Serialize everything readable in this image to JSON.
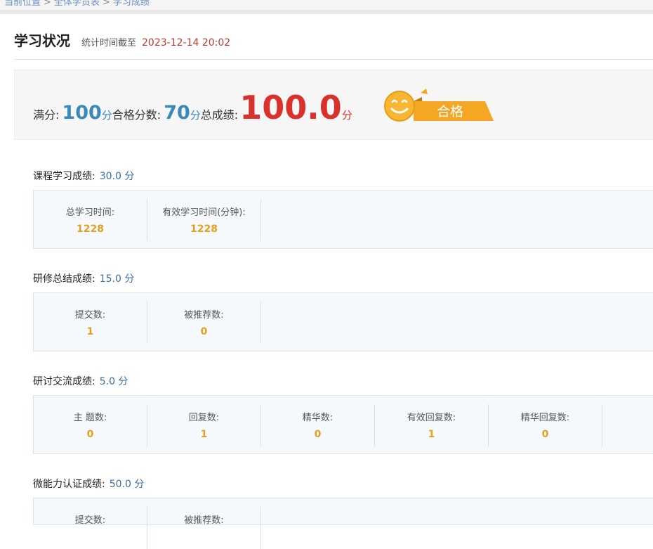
{
  "breadcrumb": [
    "当前位置",
    "全体学员表",
    "学习成绩"
  ],
  "header": {
    "title": "学习状况",
    "stat_label": "统计时间截至",
    "stat_time": "2023-12-14 20:02"
  },
  "summary": {
    "full_label": "满分:",
    "full_value": "100",
    "pass_label": "合格分数:",
    "pass_value": "70",
    "total_label": "总成绩:",
    "total_value": "100.0",
    "unit": "分",
    "badge_text": "合格",
    "badge_icon": "smiley-icon",
    "accent_color": "#f5a623"
  },
  "sections": [
    {
      "title": "课程学习成绩:",
      "score": "30.0 分",
      "cells": [
        {
          "label": "总学习时间:",
          "value": "1228"
        },
        {
          "label": "有效学习时间(分钟):",
          "value": "1228"
        }
      ]
    },
    {
      "title": "研修总结成绩:",
      "score": "15.0 分",
      "cells": [
        {
          "label": "提交数:",
          "value": "1"
        },
        {
          "label": "被推荐数:",
          "value": "0"
        }
      ]
    },
    {
      "title": "研讨交流成绩:",
      "score": "5.0 分",
      "cells": [
        {
          "label": "主 题数:",
          "value": "0"
        },
        {
          "label": "回复数:",
          "value": "1"
        },
        {
          "label": "精华数:",
          "value": "0"
        },
        {
          "label": "有效回复数:",
          "value": "1"
        },
        {
          "label": "精华回复数:",
          "value": "0"
        }
      ]
    },
    {
      "title": "微能力认证成绩:",
      "score": "50.0 分",
      "cells": [
        {
          "label": "提交数:",
          "value": ""
        },
        {
          "label": "被推荐数:",
          "value": ""
        }
      ]
    }
  ]
}
